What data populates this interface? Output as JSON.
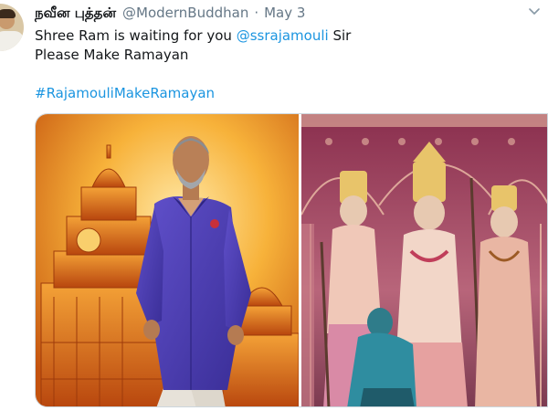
{
  "tweet": {
    "author_name": "நவீன புத்தன்",
    "handle": "@ModernBuddhan",
    "separator": "·",
    "date": "May 3",
    "text_line1_before": "Shree Ram is waiting for you ",
    "mention": "@ssrajamouli",
    "text_line1_after": " Sir",
    "text_line2": "Please Make Ramayan",
    "hashtag": "#RajamouliMakeRamayan"
  },
  "media": {
    "left_image": "man-in-purple-shirt-before-golden-temple",
    "right_image": "ramayan-characters-tableau"
  },
  "colors": {
    "link": "#1b95e0",
    "muted": "#657786",
    "text": "#14171a"
  }
}
